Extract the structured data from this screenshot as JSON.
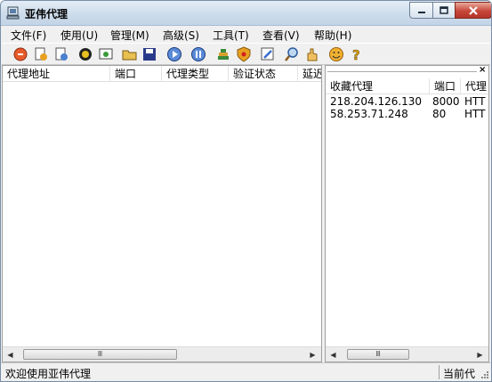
{
  "window": {
    "title": "亚伟代理"
  },
  "menu": [
    {
      "label": "文件(F)"
    },
    {
      "label": "使用(U)"
    },
    {
      "label": "管理(M)"
    },
    {
      "label": "高级(S)"
    },
    {
      "label": "工具(T)"
    },
    {
      "label": "查看(V)"
    },
    {
      "label": "帮助(H)"
    }
  ],
  "toolbar": {
    "icons": [
      "start-icon",
      "import-icon",
      "export-icon",
      "verify-icon",
      "web-icon",
      "open-folder-icon",
      "save-icon",
      "play-icon",
      "pause-icon",
      "stack-icon",
      "shield-icon",
      "edit-icon",
      "search-icon",
      "hand-icon",
      "smile-icon",
      "help-icon"
    ]
  },
  "proxy_list": {
    "columns": [
      "代理地址",
      "端口",
      "代理类型",
      "验证状态",
      "延迟"
    ],
    "rows": []
  },
  "favorites": {
    "columns": [
      "收藏代理",
      "端口",
      "代理"
    ],
    "rows": [
      {
        "address": "218.204.126.130",
        "port": "8000",
        "type": "HTT"
      },
      {
        "address": "58.253.71.248",
        "port": "80",
        "type": "HTT"
      }
    ]
  },
  "status": {
    "message": "欢迎使用亚伟代理",
    "right": "当前代"
  },
  "colors": {
    "accent": "#c3d4e7",
    "close": "#c7473a"
  }
}
